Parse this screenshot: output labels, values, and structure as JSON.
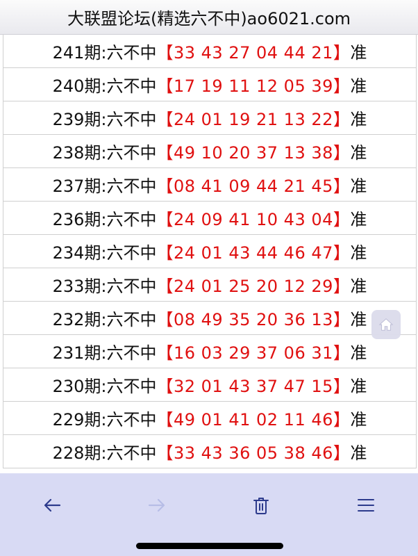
{
  "header": {
    "title": "大联盟论坛(精选六不中)ao6021.com"
  },
  "rows": [
    {
      "period": "241期:六不中",
      "numbers": "【33 43 27 04 44 21】",
      "result": "准"
    },
    {
      "period": "240期:六不中",
      "numbers": "【17 19 11 12 05 39】",
      "result": "准"
    },
    {
      "period": "239期:六不中",
      "numbers": "【24 01 19 21 13 22】",
      "result": "准"
    },
    {
      "period": "238期:六不中",
      "numbers": "【49 10 20 37 13 38】",
      "result": "准"
    },
    {
      "period": "237期:六不中",
      "numbers": "【08 41 09 44 21 45】",
      "result": "准"
    },
    {
      "period": "236期:六不中",
      "numbers": "【24 09 41 10 43 04】",
      "result": "准"
    },
    {
      "period": "234期:六不中",
      "numbers": "【24 01 43 44 46 47】",
      "result": "准"
    },
    {
      "period": "233期:六不中",
      "numbers": "【24 01 25 20 12 29】",
      "result": "准"
    },
    {
      "period": "232期:六不中",
      "numbers": "【08 49 35 20 36 13】",
      "result": "准"
    },
    {
      "period": "231期:六不中",
      "numbers": "【16 03 29 37 06 31】",
      "result": "准"
    },
    {
      "period": "230期:六不中",
      "numbers": "【32 01 43 37 47 15】",
      "result": "准"
    },
    {
      "period": "229期:六不中",
      "numbers": "【49 01 41 02 11 46】",
      "result": "准"
    },
    {
      "period": "228期:六不中",
      "numbers": "【33 43 36 05 38 46】",
      "result": "准"
    }
  ],
  "toolbar": {
    "back_icon": "arrow-left-icon",
    "forward_icon": "arrow-right-icon",
    "delete_icon": "trash-icon",
    "menu_icon": "menu-icon",
    "forward_enabled": false
  },
  "floating": {
    "home_icon": "home-icon"
  },
  "colors": {
    "numbers": "#e01010",
    "toolbar_bg": "#d8daf4",
    "icon": "#2c3a8c",
    "icon_disabled": "#b7bde6"
  }
}
